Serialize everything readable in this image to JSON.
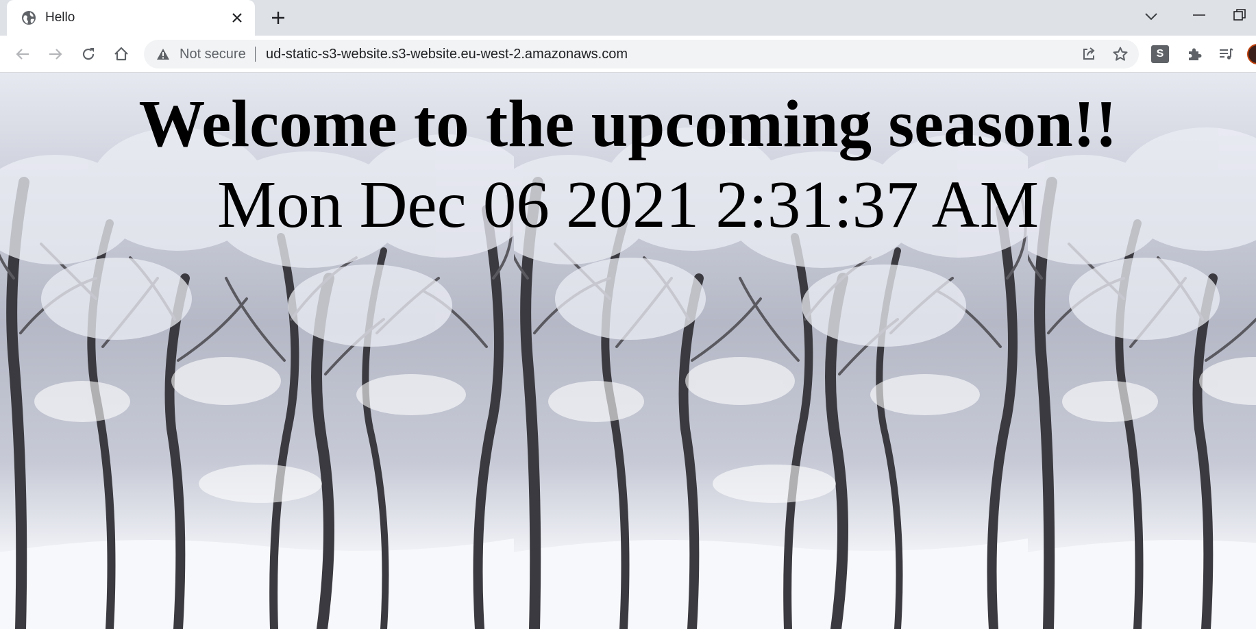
{
  "browser": {
    "tab": {
      "title": "Hello",
      "favicon": "globe-icon"
    },
    "address_bar": {
      "security_label": "Not secure",
      "url": "ud-static-s3-website.s3-website.eu-west-2.amazonaws.com"
    },
    "extension_label": "S",
    "icons": [
      "back-icon",
      "forward-icon",
      "reload-icon",
      "home-icon",
      "share-icon",
      "bookmark-star-icon",
      "extensions-icon",
      "reading-list-icon"
    ]
  },
  "page": {
    "heading": "Welcome to the upcoming season!!",
    "datetime": "Mon Dec 06 2021 2:31:37 AM",
    "background": "snowy-forest-image"
  },
  "colors": {
    "tabstrip": "#dee1e6",
    "toolbar": "#ffffff",
    "omnibox": "#f1f3f4",
    "text": "#000000"
  }
}
